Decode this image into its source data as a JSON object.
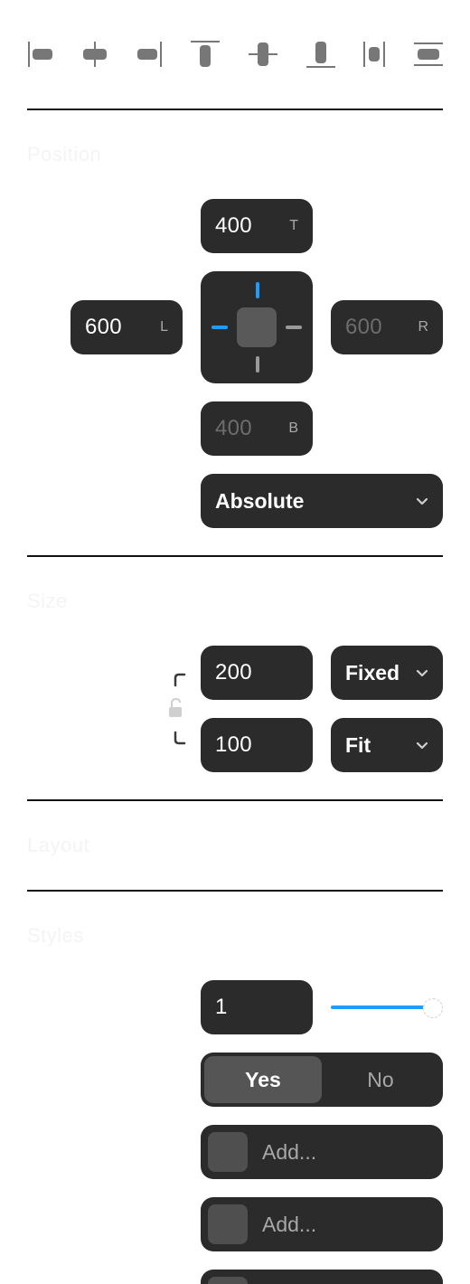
{
  "toolbar": {
    "items": [
      {
        "name": "align-left-icon"
      },
      {
        "name": "align-horizontal-center-icon"
      },
      {
        "name": "align-right-icon"
      },
      {
        "name": "align-top-icon"
      },
      {
        "name": "align-vertical-center-icon"
      },
      {
        "name": "align-bottom-icon"
      },
      {
        "name": "distribute-horizontal-icon"
      },
      {
        "name": "distribute-vertical-icon"
      }
    ]
  },
  "position": {
    "title": "Position",
    "top": {
      "value": "400",
      "suffix": "T"
    },
    "left": {
      "value": "600",
      "suffix": "L"
    },
    "right": {
      "value": "600",
      "suffix": "R"
    },
    "bottom": {
      "value": "400",
      "suffix": "B"
    },
    "mode": "Absolute"
  },
  "size": {
    "title": "Size",
    "width": {
      "value": "200",
      "mode": "Fixed"
    },
    "height": {
      "value": "100",
      "mode": "Fit"
    }
  },
  "layout": {
    "title": "Layout"
  },
  "styles": {
    "title": "Styles",
    "opacity": {
      "value": "1",
      "slider_fraction": 1.0
    },
    "toggle": {
      "yes": "Yes",
      "no": "No",
      "selected": "Yes"
    },
    "fills": [
      {
        "label": "Add..."
      },
      {
        "label": "Add..."
      }
    ]
  },
  "colors": {
    "panel": "#2b2b2b",
    "accent": "#1f9dff",
    "divider": "#111111"
  }
}
